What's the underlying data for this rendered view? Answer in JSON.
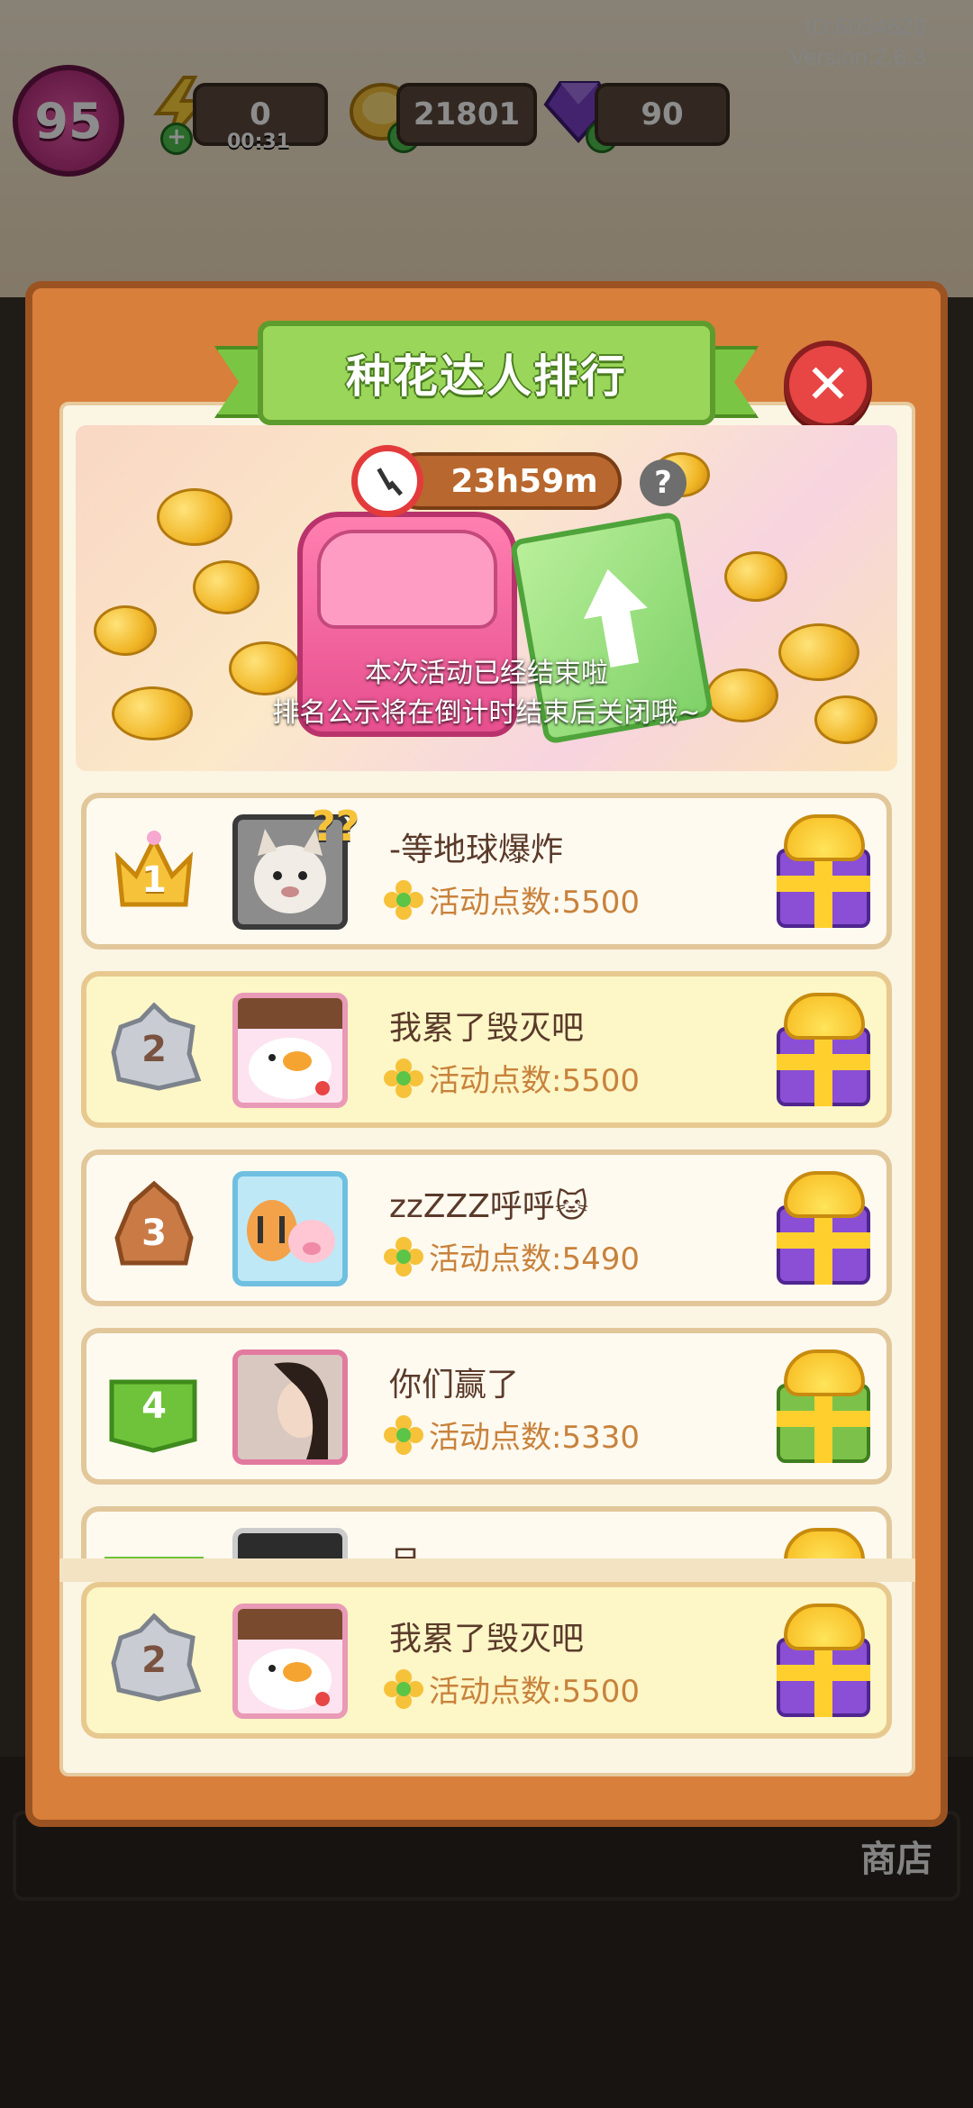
{
  "hud": {
    "id_text": "ID:6034629",
    "version_text": "Version:2.6.3",
    "level": "95",
    "energy": "0",
    "energy_timer": "00:31",
    "coins": "21801",
    "gems": "90"
  },
  "panel": {
    "title": "种花达人排行",
    "countdown": "23h59m",
    "help": "?",
    "notice_line1": "本次活动已经结束啦",
    "notice_line2": "排名公示将在倒计时结束后关闭哦~"
  },
  "ranking": [
    {
      "rank": "1",
      "name": "-等地球爆炸",
      "points": "活动点数:5500"
    },
    {
      "rank": "2",
      "name": "我累了毁灭吧",
      "points": "活动点数:5500"
    },
    {
      "rank": "3",
      "name": "zzZZZ呼呼🐱",
      "points": "活动点数:5490"
    },
    {
      "rank": "4",
      "name": "你们赢了",
      "points": "活动点数:5330"
    },
    {
      "rank": "",
      "name": "吕",
      "points": ""
    }
  ],
  "my_rank": {
    "rank": "2",
    "name": "我累了毁灭吧",
    "points": "活动点数:5500"
  },
  "bottom": {
    "shop_label": "商店"
  },
  "colors": {
    "panel": "#d87f3c",
    "title_green": "#9ad65a",
    "close_red": "#e84545",
    "gold": "#f0b525",
    "silver": "#c9cdd3",
    "bronze": "#c97a45",
    "green_rank": "#6fc33a",
    "purple_gift": "#8a4fd4",
    "green_gift": "#7cc24a"
  }
}
